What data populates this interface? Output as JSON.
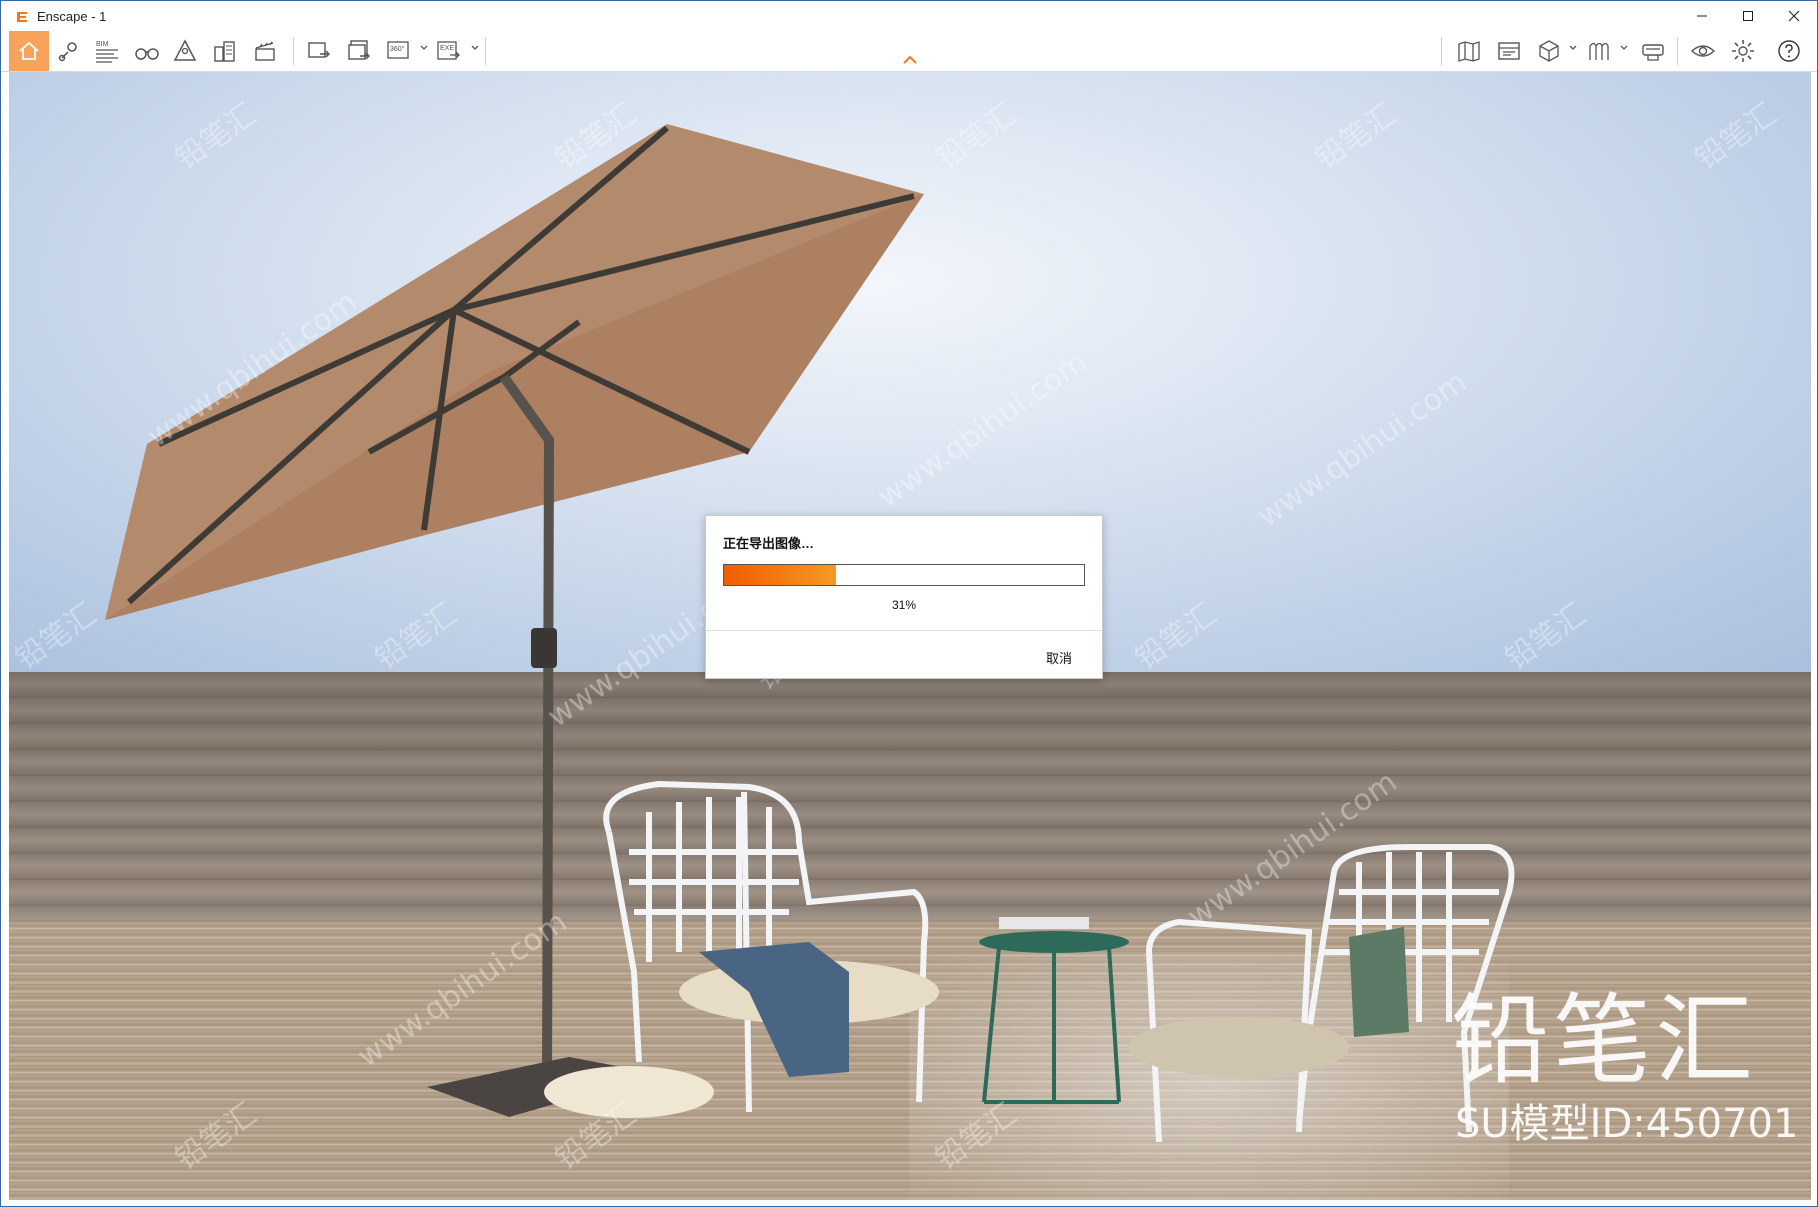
{
  "window": {
    "title": "Enscape - 1",
    "accent": "#f7a35c"
  },
  "toolbar": {
    "left_buttons": [
      "home-icon",
      "location-pin-icon",
      "bim-icon",
      "binoculars-icon",
      "walk-mode-icon",
      "buildings-icon",
      "clapper-icon"
    ],
    "export_buttons": [
      "screenshot-export-icon",
      "batch-export-icon",
      "panorama-360-icon",
      "exe-export-icon"
    ],
    "bim_label": "BIM",
    "pano_label": "360°",
    "exe_label": "EXE",
    "right_buttons": [
      "map-icon",
      "asset-library-icon",
      "view-cube-icon",
      "materials-icon",
      "vr-headset-icon",
      "eye-icon",
      "settings-gear-icon",
      "help-icon"
    ]
  },
  "dialog": {
    "title": "正在导出图像…",
    "progress": 0.31,
    "progress_text": "31%",
    "cancel_label": "取消",
    "progress_color_start": "#f25c00",
    "progress_color_end": "#f59a23"
  },
  "watermark": {
    "brand": "铅笔汇",
    "model_id": "SU模型ID:450701",
    "url_text": "www.qbihui.com"
  }
}
